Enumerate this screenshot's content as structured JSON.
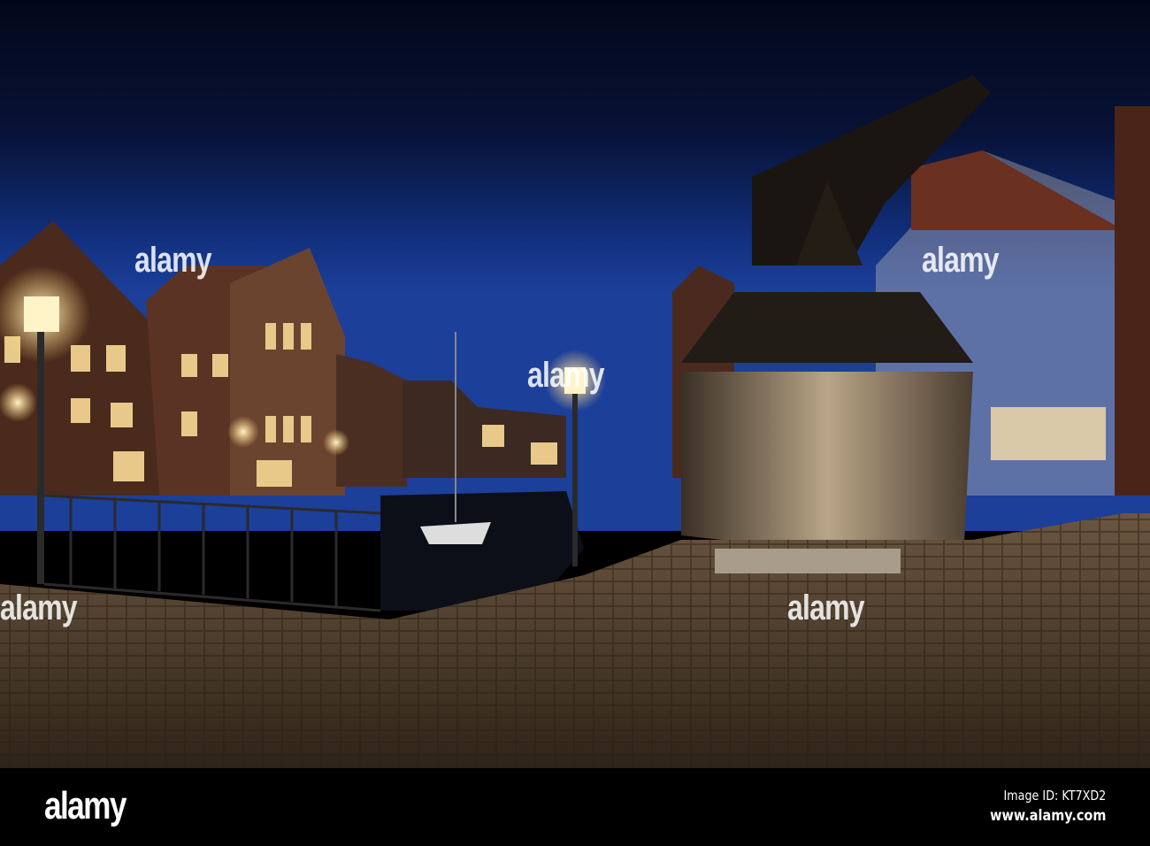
{
  "photo": {
    "subject": "Night harbor scene with wooden crane, half-timbered houses and cobblestones",
    "colors": {
      "sky_top": "#050a1e",
      "sky_horizon": "#1c3f9a",
      "ground": "#5a4632",
      "lamp": "#fff4c8"
    }
  },
  "watermark": {
    "text": "alamy"
  },
  "footer": {
    "logo": "alamy",
    "image_id": "Image ID: KT7XD2",
    "site": "www.alamy.com"
  }
}
